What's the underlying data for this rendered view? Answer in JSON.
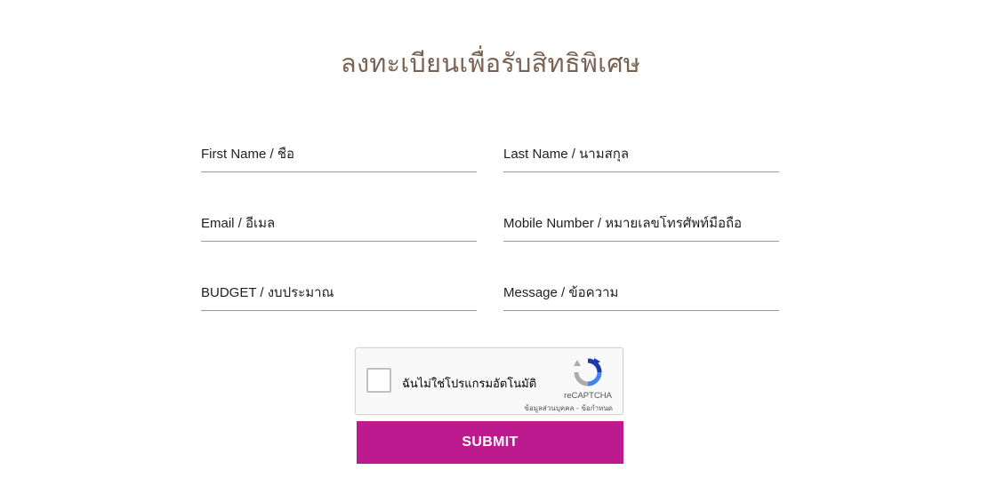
{
  "form": {
    "title": "ลงทะเบียนเพื่อรับสิทธิพิเศษ",
    "fields": {
      "first_name": {
        "placeholder": "First Name / ชื่อ",
        "value": ""
      },
      "last_name": {
        "placeholder": "Last Name / นามสกุล",
        "value": ""
      },
      "email": {
        "placeholder": "Email / อีเมล",
        "value": ""
      },
      "mobile": {
        "placeholder": "Mobile Number / หมายเลขโทรศัพท์มือถือ",
        "value": ""
      },
      "budget": {
        "placeholder": "BUDGET / งบประมาณ",
        "value": ""
      },
      "message": {
        "placeholder": "Message / ข้อความ",
        "value": ""
      }
    },
    "submit_label": "SUBMIT"
  },
  "recaptcha": {
    "label": "ฉันไม่ใช่โปรแกรมอัตโนมัติ",
    "brand": "reCAPTCHA",
    "privacy_label": "ข้อมูลส่วนบุคคล",
    "separator": " - ",
    "terms_label": "ข้อกำหนด",
    "logo_icon": "recaptcha-logo-icon"
  },
  "colors": {
    "title": "#7a6352",
    "submit_bg": "#bd1a8f",
    "field_border": "#9a9a9a"
  }
}
